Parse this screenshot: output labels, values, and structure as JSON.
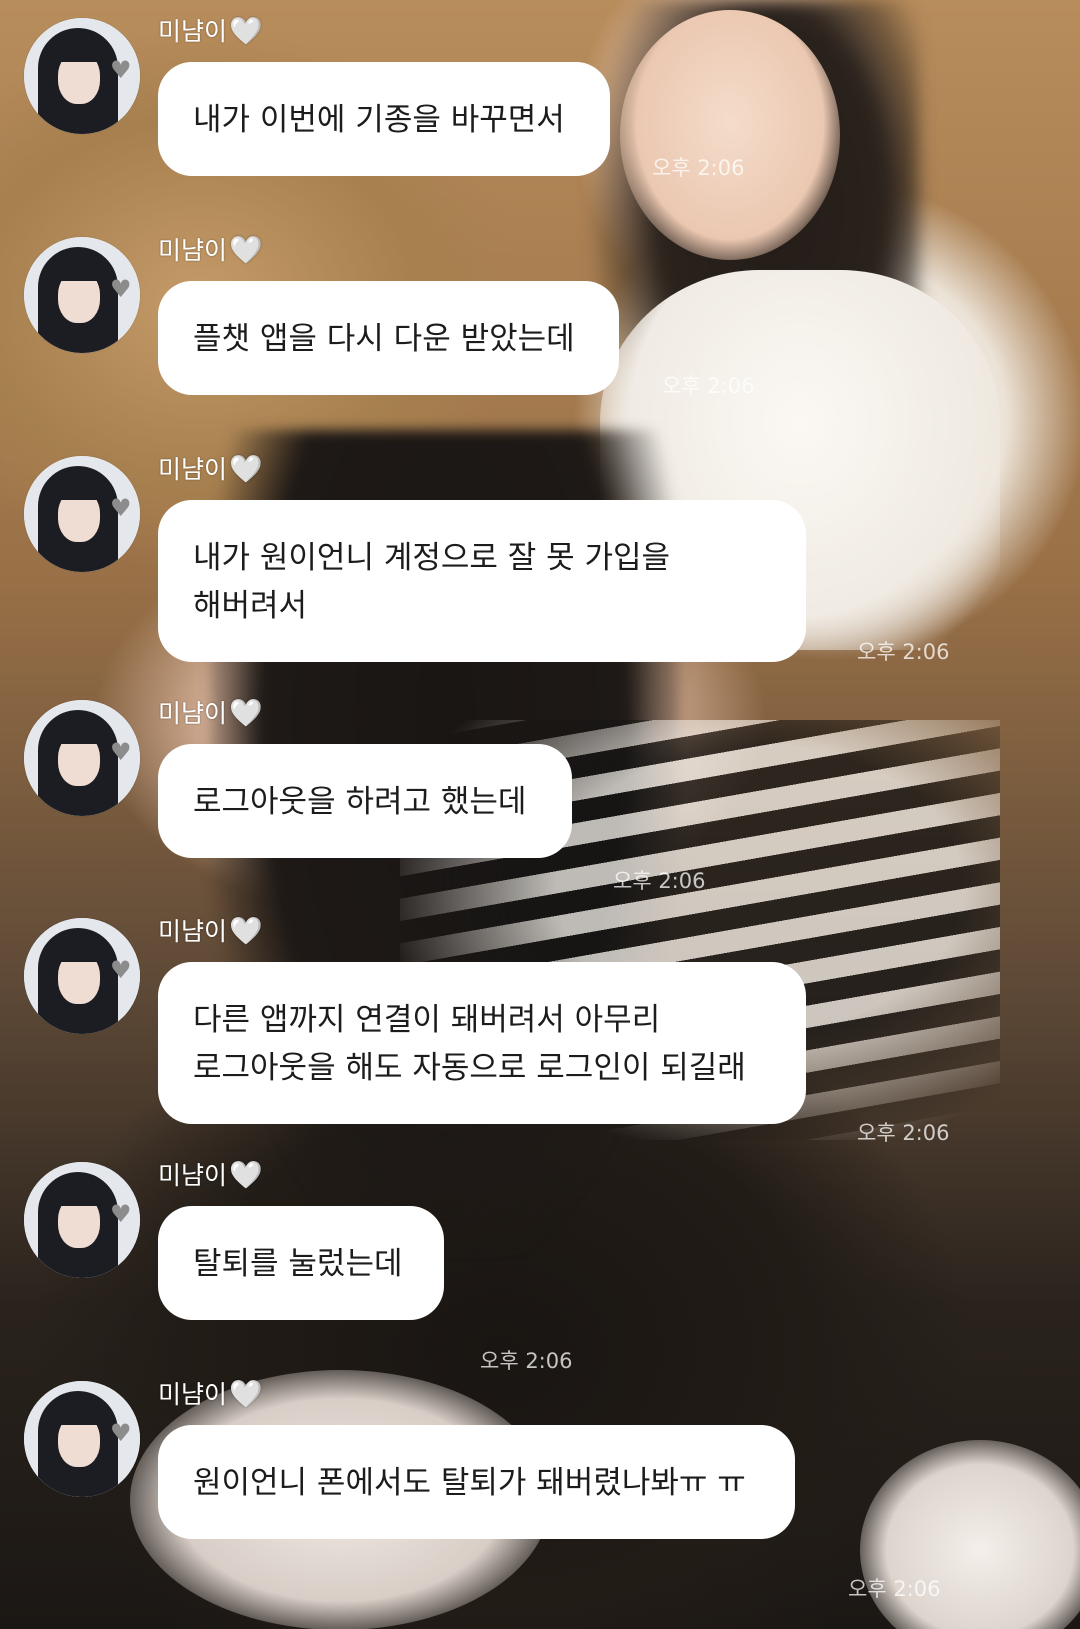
{
  "background": {
    "description_colors": [
      "#b88d5c",
      "#1b1714"
    ]
  },
  "colors": {
    "bubble": "#ffffff",
    "name_text": "#ffffff",
    "time_text": "#ffffffbf"
  },
  "messages": [
    {
      "sender": "미냠이",
      "heart": "🤍",
      "lines": [
        "내가 이번에 기종을 바꾸면서"
      ],
      "time": "오후 2:06"
    },
    {
      "sender": "미냠이",
      "heart": "🤍",
      "lines": [
        "플챗 앱을 다시 다운 받았는데"
      ],
      "time": "오후 2:06"
    },
    {
      "sender": "미냠이",
      "heart": "🤍",
      "lines": [
        "내가 원이언니 계정으로 잘 못 가입을",
        "해버려서"
      ],
      "time": "오후 2:06"
    },
    {
      "sender": "미냠이",
      "heart": "🤍",
      "lines": [
        "로그아웃을 하려고 했는데"
      ],
      "time": "오후 2:06"
    },
    {
      "sender": "미냠이",
      "heart": "🤍",
      "lines": [
        "다른 앱까지 연결이 돼버려서 아무리",
        "로그아웃을 해도 자동으로 로그인이 되길래"
      ],
      "time": "오후 2:06"
    },
    {
      "sender": "미냠이",
      "heart": "🤍",
      "lines": [
        "탈퇴를 눌렀는데"
      ],
      "time": "오후 2:06"
    },
    {
      "sender": "미냠이",
      "heart": "🤍",
      "lines": [
        "원이언니 폰에서도 탈퇴가 돼버렸나봐ㅠ ㅠ"
      ],
      "time": "오후 2:06"
    }
  ],
  "avatar_icon": "profile-photo",
  "avatar_badge": "gray-heart-icon"
}
